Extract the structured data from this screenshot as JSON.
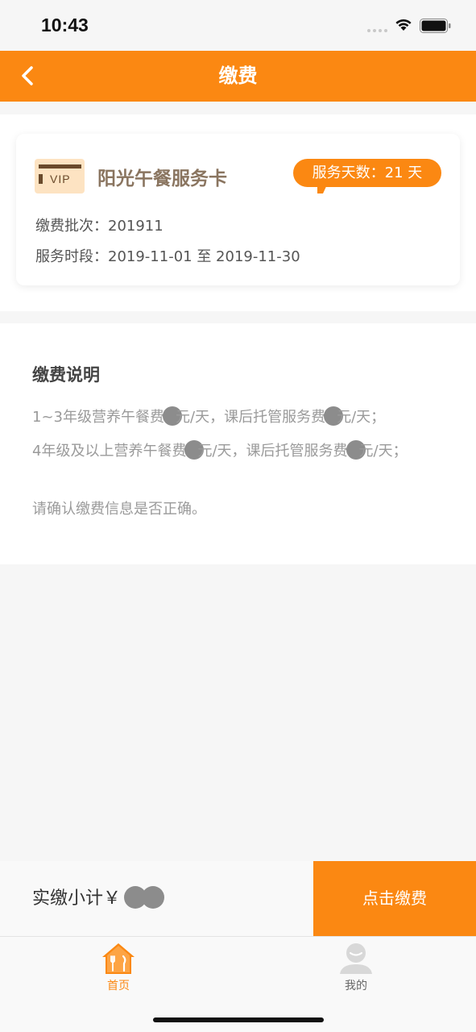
{
  "status_bar": {
    "time": "10:43"
  },
  "nav": {
    "back_icon": "chevron-left-icon",
    "title": "缴费"
  },
  "card": {
    "icon_text": "VIP",
    "title": "阳光午餐服务卡",
    "days_badge": "服务天数：21 天",
    "batch_label": "缴费批次：",
    "batch_value": "201911",
    "period_label": "服务时段：",
    "period_value": "2019-11-01 至 2019-11-30"
  },
  "description": {
    "title": "缴费说明",
    "line1": {
      "a": "1~3年级营养午餐费",
      "b": "元/天，课后托管服务费",
      "c": "元/天；"
    },
    "line2": {
      "a": "4年级及以上营养午餐费",
      "b": "元/天，课后托管服务费",
      "c": "元/天；"
    },
    "line3": "请确认缴费信息是否正确。"
  },
  "pay_bar": {
    "subtotal_label": "实缴小计￥",
    "pay_button": "点击缴费"
  },
  "tabs": [
    {
      "label": "首页",
      "icon": "home-icon",
      "active": true
    },
    {
      "label": "我的",
      "icon": "user-icon",
      "active": false
    }
  ],
  "colors": {
    "accent": "#fb8812",
    "card_title": "#8a7560"
  }
}
